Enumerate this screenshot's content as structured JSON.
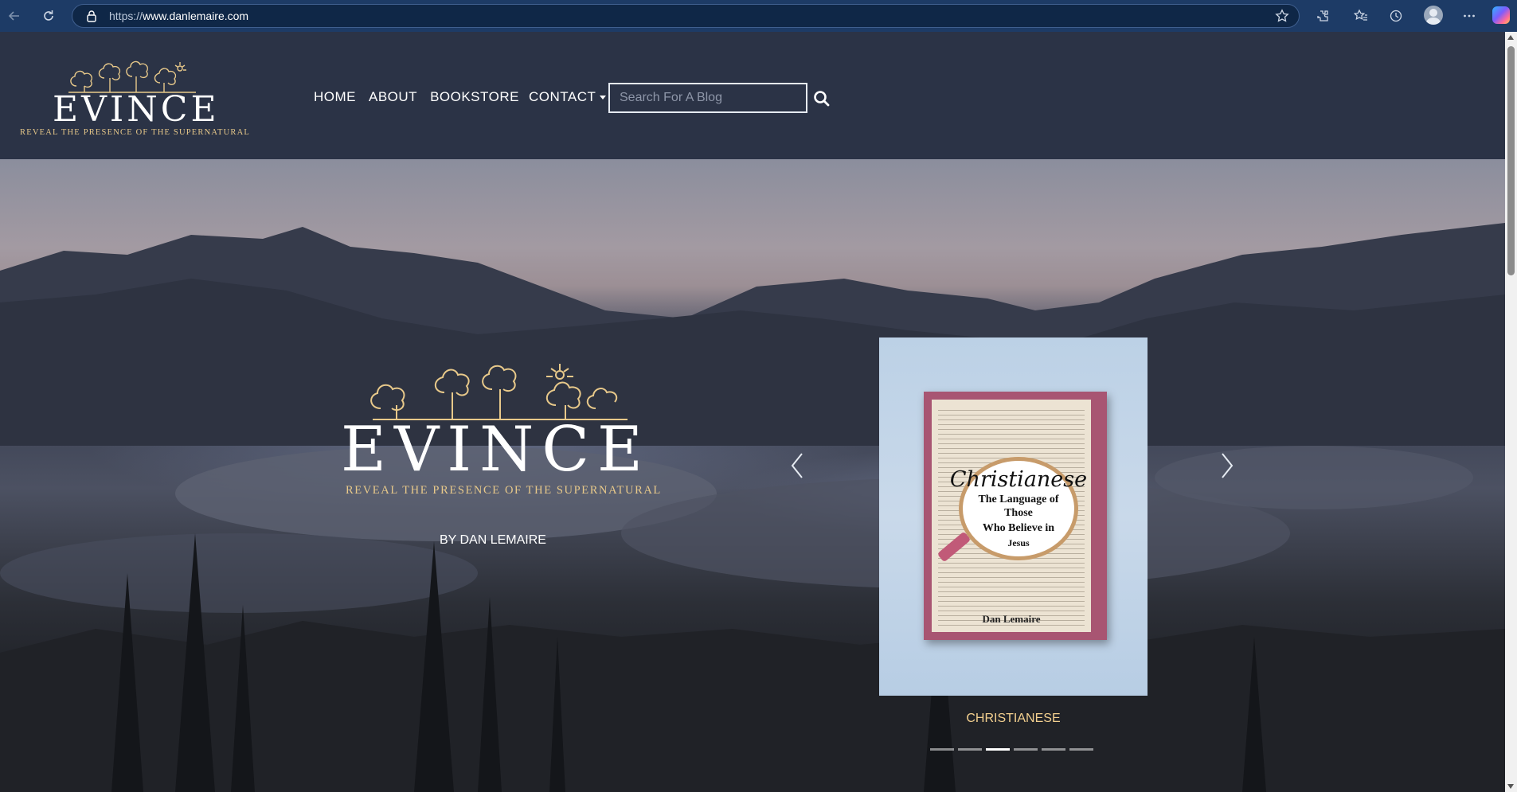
{
  "browser": {
    "url_scheme": "https://",
    "url_host": "www.danlemaire.com",
    "icons": [
      "back-icon",
      "reload-icon",
      "lock-icon",
      "star-icon",
      "extensions-icon",
      "favorites-icon",
      "history-icon",
      "profile-icon",
      "more-icon",
      "copilot-icon"
    ]
  },
  "header": {
    "logo_word": "EVINCE",
    "logo_tagline": "REVEAL THE PRESENCE OF THE SUPERNATURAL",
    "nav": {
      "home": "HOME",
      "about": "ABOUT",
      "bookstore": "BOOKSTORE",
      "contact": "CONTACT"
    },
    "search": {
      "placeholder": "Search For A Blog",
      "value": ""
    }
  },
  "hero": {
    "logo_word": "EVINCE",
    "tagline": "REVEAL THE PRESENCE OF THE SUPERNATURAL",
    "byline": "BY DAN LEMAIRE",
    "carousel": {
      "book_title": "Christianese",
      "book_subtitle_1": "The Language of Those",
      "book_subtitle_2": "Who Believe in",
      "book_subtitle_3": "Jesus",
      "book_author": "Dan Lemaire",
      "caption": "CHRISTIANESE",
      "indicator_count": 6,
      "active_index": 2
    }
  },
  "colors": {
    "browser_bar": "#1d3b66",
    "header_bg": "#2b3346",
    "accent_gold": "#e8c98a",
    "caption_gold": "#f3d08f"
  }
}
